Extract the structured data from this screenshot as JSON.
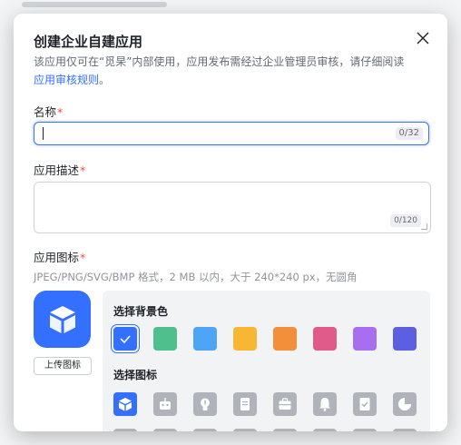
{
  "dialog": {
    "title": "创建企业自建应用",
    "description_text": "该应用仅可在“觅杲”内部使用，应用发布需经过企业管理员审核，请仔细阅读 ",
    "description_link": "应用审核规则",
    "description_end": "。"
  },
  "name_field": {
    "label": "名称",
    "required_mark": "*",
    "value": "",
    "counter": "0/32"
  },
  "description_field": {
    "label": "应用描述",
    "required_mark": "*",
    "value": "",
    "counter": "0/120"
  },
  "icon_section": {
    "label": "应用图标",
    "required_mark": "*",
    "hint": "JPEG/PNG/SVG/BMP 格式，2 MB 以内，大于 240*240 px，无圆角",
    "upload_label": "上传图标"
  },
  "background_picker": {
    "label": "选择背景色",
    "selected_index": 0,
    "colors": [
      "#3370ff",
      "#4fc08d",
      "#4ea4f5",
      "#f7b733",
      "#f38f3a",
      "#e05a8a",
      "#a86ef0",
      "#5b5fe0"
    ]
  },
  "icon_picker": {
    "label": "选择图标",
    "selected_index": 0,
    "icons": [
      "cube-icon",
      "robot-icon",
      "lightbulb-icon",
      "document-icon",
      "briefcase-icon",
      "bell-icon",
      "checklist-icon",
      "pie-chart-icon"
    ]
  },
  "colors": {
    "accent": "#3370ff",
    "required": "#f54a45",
    "icon_inactive": "#b0b4ba"
  }
}
